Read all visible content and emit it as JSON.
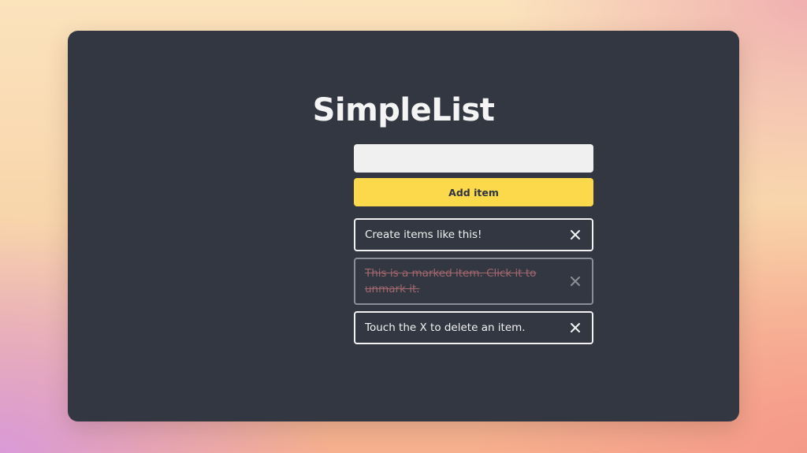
{
  "app": {
    "title": "SimpleList"
  },
  "form": {
    "input_value": "",
    "input_placeholder": "",
    "add_label": "Add item"
  },
  "items": [
    {
      "text": "Create items like this!",
      "marked": false,
      "delete_icon": "close-icon"
    },
    {
      "text": "This is a marked item. Click it to unmark it.",
      "marked": true,
      "delete_icon": "close-icon"
    },
    {
      "text": "Touch the X to delete an item.",
      "marked": false,
      "delete_icon": "close-icon"
    }
  ],
  "colors": {
    "card_background": "#323741",
    "accent_button": "#fbd94a",
    "marked_text": "#a3676e",
    "input_background": "#f0f0f0"
  }
}
